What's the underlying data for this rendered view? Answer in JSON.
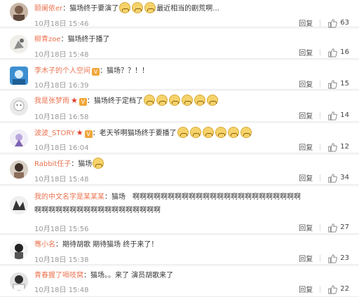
{
  "reply_label": "回复",
  "comments": [
    {
      "user": "颐阑依er",
      "parts": [
        "：猫场终于要演了",
        "最近相当的剧荒啊..."
      ],
      "emoji_count": 3,
      "time": "10月18日 15:46",
      "likes": "63"
    },
    {
      "user": "柳青zoe",
      "parts": [
        "：猫场终于播了"
      ],
      "time": "10月18日 15:48",
      "likes": "16"
    },
    {
      "user": "李木子的个人空间",
      "parts": [
        "：猫场？？！！"
      ],
      "time": "10月18日 16:39",
      "likes": "15"
    },
    {
      "user": "我是张梦雨",
      "parts": [
        "：猫场终于定档了"
      ],
      "emoji_count": 6,
      "time": "10月18日 16:58",
      "likes": "14"
    },
    {
      "user": "波波_STORY",
      "parts": [
        "：老天爷啊猫场终于要播了"
      ],
      "emoji_count": 6,
      "time": "10月18日 16:04",
      "likes": "12"
    },
    {
      "user": "Rabbit任子",
      "parts": [
        "：猫场"
      ],
      "emoji_count": 1,
      "time": "10月18日 15:48",
      "likes": "34"
    },
    {
      "user": "我的中文名字是某某某",
      "parts": [
        "：猫场　啊啊啊啊啊啊啊啊啊啊啊啊啊啊啊啊啊啊啊啊啊啊啊啊啊啊啊啊啊啊啊啊啊啊啊啊啊啊啊啊啊啊"
      ],
      "time": "10月18日 15:56",
      "likes": "27"
    },
    {
      "user": "骞小名",
      "parts": [
        "：期待胡歌 期待猫场 终于来了！"
      ],
      "time": "10月18日 15:38",
      "likes": "23"
    },
    {
      "user": "青春握了嗝吱窝",
      "parts": [
        "：猫场。。来了 演员胡歌来了"
      ],
      "time": "10月18日 15:48",
      "likes": "22"
    }
  ]
}
